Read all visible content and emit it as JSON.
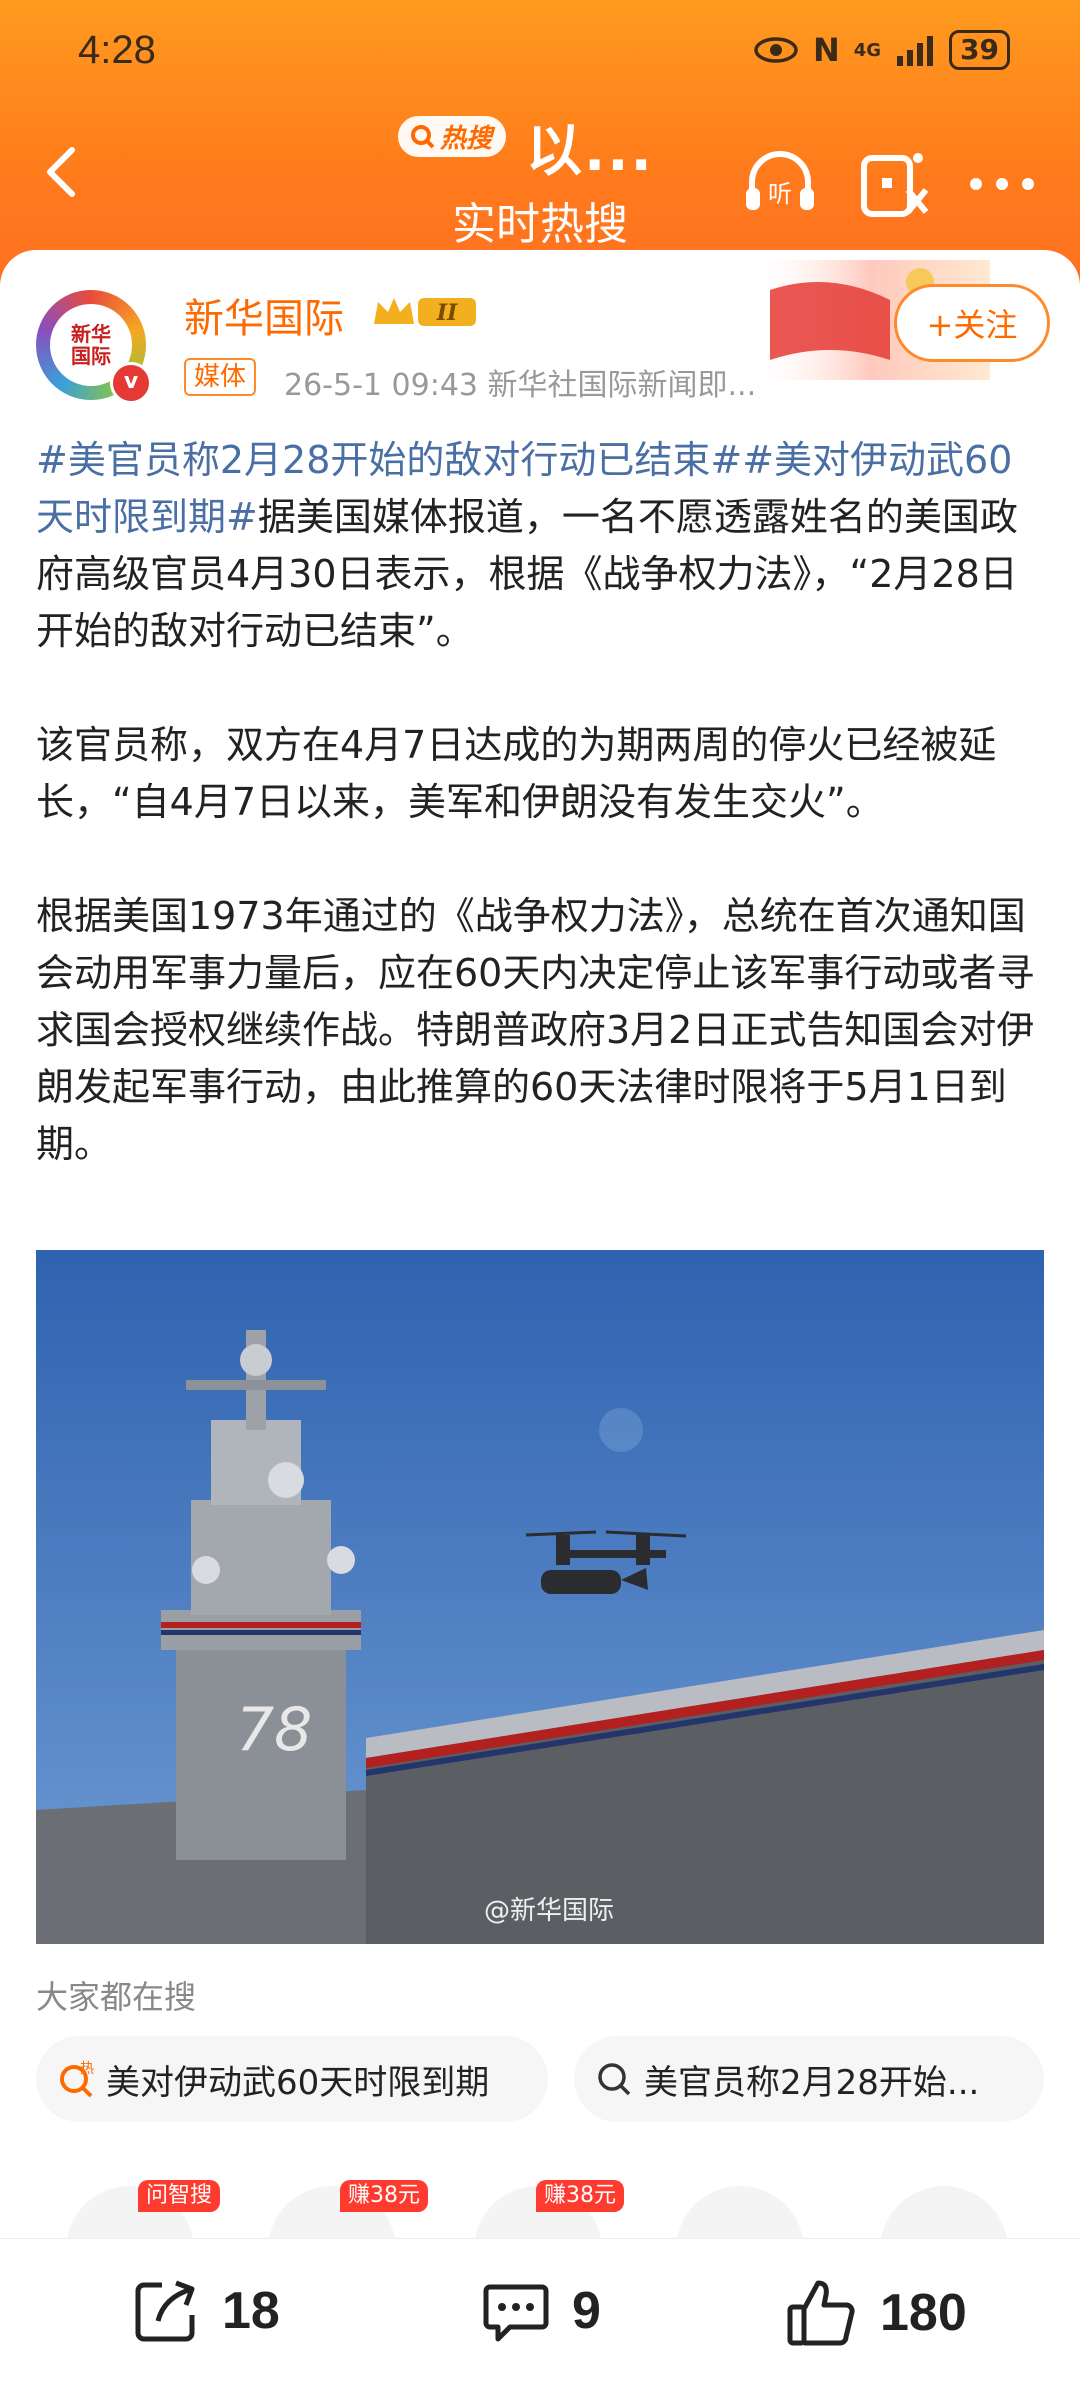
{
  "status_bar": {
    "time": "4:28",
    "network": "4G",
    "battery": "39"
  },
  "header": {
    "hot_label": "热搜",
    "title": "以...",
    "subtitle": "实时热搜",
    "icons": [
      "back-icon",
      "listen-icon",
      "red-packet-icon",
      "more-icon"
    ]
  },
  "post": {
    "author": "新华国际",
    "avatar_text": "新华\n国际",
    "level": "II",
    "media_tag": "媒体",
    "meta": "26-5-1 09:43   新华社国际新闻即...",
    "follow_label": "+关注",
    "hashtag1": "#美官员称2月28开始的敌对行动已结束#",
    "hashtag2": "#美对伊动武60天时限到期#",
    "para1": "据美国媒体报道，一名不愿透露姓名的美国政府高级官员4月30日表示，根据《战争权力法》，“2月28日开始的敌对行动已结束”。",
    "para2": "该官员称，双方在4月7日达成的为期两周的停火已经被延长，“自4月7日以来，美军和伊朗没有发生交火”。",
    "para3": "根据美国1973年通过的《战争权力法》，总统在首次通知国会动用军事力量后，应在60天内决定停止该军事行动或者寻求国会授权继续作战。特朗普政府3月2日正式告知国会对伊朗发起军事行动，由此推算的60天法律时限将于5月1日到期。",
    "watermark": "@新华国际"
  },
  "related": {
    "title": "大家都在搜",
    "chips": [
      "美对伊动武60天时限到期",
      "美官员称2月28开始..."
    ],
    "badges": [
      "问智搜",
      "赚38元",
      "赚38元"
    ]
  },
  "actions": {
    "share": "18",
    "comment": "9",
    "like": "180"
  }
}
